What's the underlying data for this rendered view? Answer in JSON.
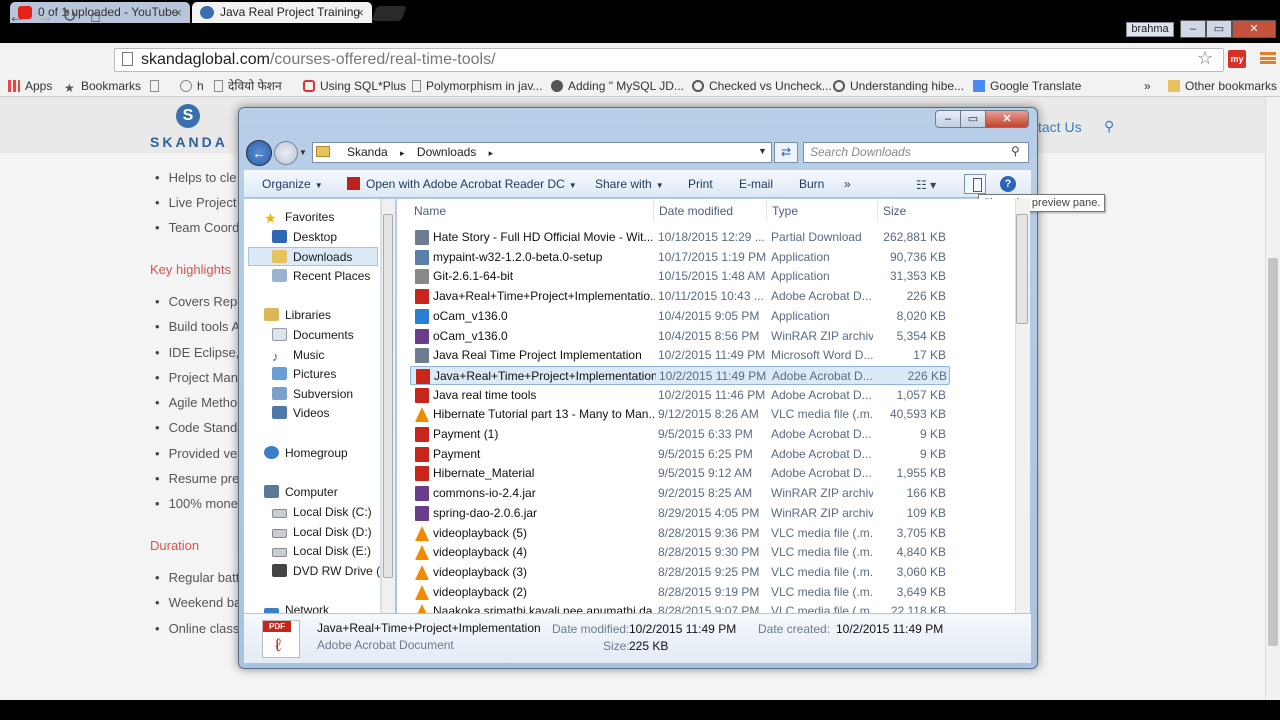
{
  "browser": {
    "tabs": [
      {
        "title": "0 of 1 uploaded - YouTube",
        "active": false
      },
      {
        "title": "Java Real Project Training",
        "active": true
      }
    ],
    "user": "brahma",
    "url_domain": "skandaglobal.com",
    "url_path": "/courses-offered/real-time-tools/",
    "bookmarks": [
      "Apps",
      "Bookmarks",
      "h",
      "देवियो फेशन",
      "Using SQL*Plus",
      "Polymorphism in jav...",
      "Adding \" MySQL JD...",
      "Checked vs Uncheck...",
      "Understanding hibe...",
      "Google Translate",
      "»",
      "Other bookmarks"
    ],
    "ext_label": "my"
  },
  "site": {
    "logo": "SKANDA",
    "logo_mark": "S",
    "contact": "tact Us",
    "list1": [
      "Helps to cle",
      "Live Project",
      "Team Coord"
    ],
    "heading_highlights": "Key highlights",
    "list2": [
      "Covers Repo",
      "Build tools A",
      "IDE Eclipse,",
      "Project Man",
      "Agile Metho",
      "Code Standa",
      "Provided ve",
      "Resume pre",
      "100% mone"
    ],
    "heading_duration": "Duration",
    "list3": [
      "Regular batt",
      "Weekend ba",
      "Online class"
    ]
  },
  "explorer": {
    "address": [
      "Skanda",
      "▸",
      "Downloads",
      "▸"
    ],
    "search_placeholder": "Search Downloads",
    "commands": {
      "organize": "Organize",
      "open_with": "Open with Adobe Acrobat Reader DC",
      "share_with": "Share with",
      "print": "Print",
      "email": "E-mail",
      "burn": "Burn",
      "more": "»"
    },
    "tooltip": "Show the preview pane.",
    "nav": {
      "favorites": "Favorites",
      "desktop": "Desktop",
      "downloads": "Downloads",
      "recent": "Recent Places",
      "libraries": "Libraries",
      "documents": "Documents",
      "music": "Music",
      "pictures": "Pictures",
      "subversion": "Subversion",
      "videos": "Videos",
      "homegroup": "Homegroup",
      "computer": "Computer",
      "disk_c": "Local Disk (C:)",
      "disk_d": "Local Disk (D:)",
      "disk_e": "Local Disk (E:)",
      "dvd": "DVD RW Drive (F:)",
      "network": "Network"
    },
    "columns": {
      "name": "Name",
      "date": "Date modified",
      "type": "Type",
      "size": "Size"
    },
    "files": [
      {
        "name": "Hate Story - Full HD Official Movie - Wit...",
        "date": "10/18/2015 12:29 ...",
        "type": "Partial Download",
        "size": "262,881 KB",
        "icon": "doc"
      },
      {
        "name": "mypaint-w32-1.2.0-beta.0-setup",
        "date": "10/17/2015 1:19 PM",
        "type": "Application",
        "size": "90,736 KB",
        "icon": "app"
      },
      {
        "name": "Git-2.6.1-64-bit",
        "date": "10/15/2015 1:48 AM",
        "type": "Application",
        "size": "31,353 KB",
        "icon": "git"
      },
      {
        "name": "Java+Real+Time+Project+Implementatio...",
        "date": "10/11/2015 10:43 ...",
        "type": "Adobe Acrobat D...",
        "size": "226 KB",
        "icon": "pdf"
      },
      {
        "name": "oCam_v136.0",
        "date": "10/4/2015 9:05 PM",
        "type": "Application",
        "size": "8,020 KB",
        "icon": "ocam"
      },
      {
        "name": "oCam_v136.0",
        "date": "10/4/2015 8:56 PM",
        "type": "WinRAR ZIP archive",
        "size": "5,354 KB",
        "icon": "rar"
      },
      {
        "name": "Java Real Time Project Implementation",
        "date": "10/2/2015 11:49 PM",
        "type": "Microsoft Word D...",
        "size": "17 KB",
        "icon": "doc"
      },
      {
        "name": "Java+Real+Time+Project+Implementation",
        "date": "10/2/2015 11:49 PM",
        "type": "Adobe Acrobat D...",
        "size": "226 KB",
        "icon": "pdf",
        "selected": true
      },
      {
        "name": "Java real time tools",
        "date": "10/2/2015 11:46 PM",
        "type": "Adobe Acrobat D...",
        "size": "1,057 KB",
        "icon": "pdf"
      },
      {
        "name": "Hibernate Tutorial part 13 - Many to Man...",
        "date": "9/12/2015 8:26 AM",
        "type": "VLC media file (.m...",
        "size": "40,593 KB",
        "icon": "vlc"
      },
      {
        "name": "Payment (1)",
        "date": "9/5/2015 6:33 PM",
        "type": "Adobe Acrobat D...",
        "size": "9 KB",
        "icon": "pdf"
      },
      {
        "name": "Payment",
        "date": "9/5/2015 6:25 PM",
        "type": "Adobe Acrobat D...",
        "size": "9 KB",
        "icon": "pdf"
      },
      {
        "name": "Hibernate_Material",
        "date": "9/5/2015 9:12 AM",
        "type": "Adobe Acrobat D...",
        "size": "1,955 KB",
        "icon": "pdf"
      },
      {
        "name": "commons-io-2.4.jar",
        "date": "9/2/2015 8:25 AM",
        "type": "WinRAR ZIP archive",
        "size": "166 KB",
        "icon": "rar"
      },
      {
        "name": "spring-dao-2.0.6.jar",
        "date": "8/29/2015 4:05 PM",
        "type": "WinRAR ZIP archive",
        "size": "109 KB",
        "icon": "rar"
      },
      {
        "name": "videoplayback (5)",
        "date": "8/28/2015 9:36 PM",
        "type": "VLC media file (.m...",
        "size": "3,705 KB",
        "icon": "vlc"
      },
      {
        "name": "videoplayback (4)",
        "date": "8/28/2015 9:30 PM",
        "type": "VLC media file (.m...",
        "size": "4,840 KB",
        "icon": "vlc"
      },
      {
        "name": "videoplayback (3)",
        "date": "8/28/2015 9:25 PM",
        "type": "VLC media file (.m...",
        "size": "3,060 KB",
        "icon": "vlc"
      },
      {
        "name": "videoplayback (2)",
        "date": "8/28/2015 9:19 PM",
        "type": "VLC media file (.m...",
        "size": "3,649 KB",
        "icon": "vlc"
      },
      {
        "name": "Naakoka srimathi kavali nee anumathi da...",
        "date": "8/28/2015 9:07 PM",
        "type": "VLC media file (.m...",
        "size": "22,118 KB",
        "icon": "vlc"
      }
    ],
    "details": {
      "name": "Java+Real+Time+Project+Implementation",
      "kind": "Adobe Acrobat Document",
      "modified_label": "Date modified:",
      "modified": "10/2/2015 11:49 PM",
      "created_label": "Date created:",
      "created": "10/2/2015 11:49 PM",
      "size_label": "Size:",
      "size": "225 KB",
      "pdf_label": "PDF"
    }
  },
  "icon_colors": {
    "pdf": "#c8261d",
    "vlc": "#f08a00",
    "rar": "#6a3d8a",
    "app": "#5a7fa8",
    "doc": "#6d7c90",
    "git": "#888888",
    "ocam": "#2a7fd4"
  }
}
